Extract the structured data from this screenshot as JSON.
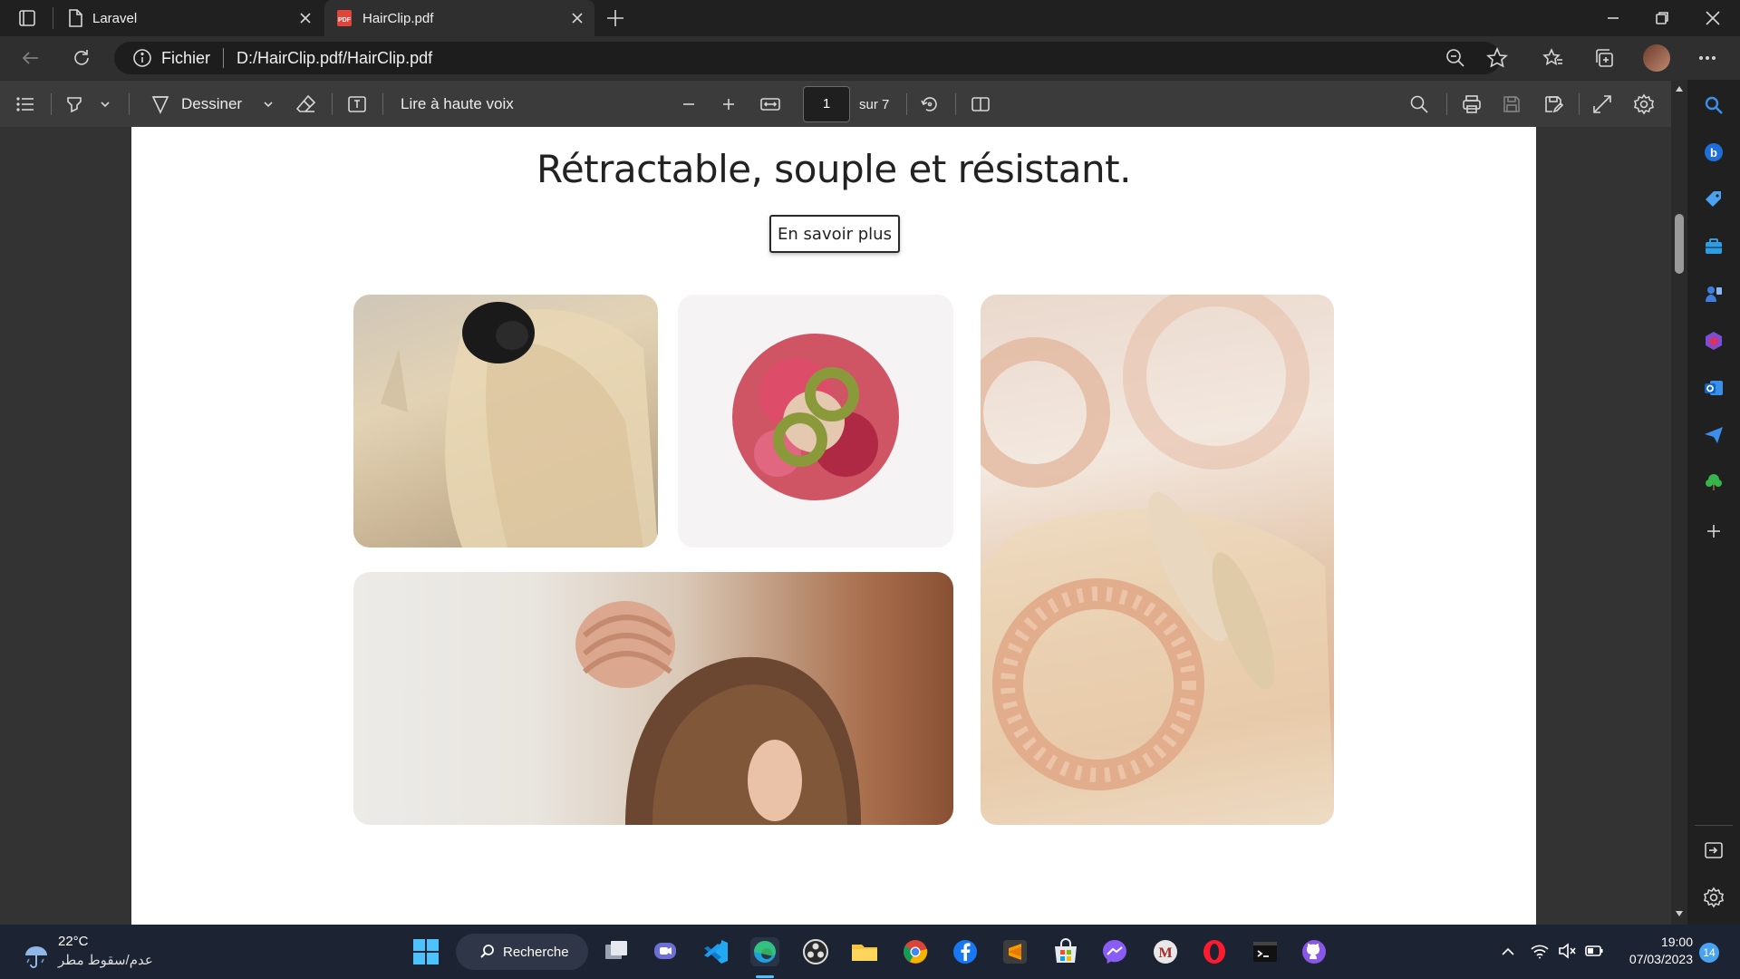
{
  "browser": {
    "tabs": [
      {
        "label": "Laravel",
        "icon": "page-icon",
        "active": false
      },
      {
        "label": "HairClip.pdf",
        "icon": "pdf-icon",
        "active": true
      }
    ],
    "address": {
      "prefix": "Fichier",
      "path": "D:/HairClip.pdf/HairClip.pdf"
    }
  },
  "pdf_toolbar": {
    "draw_label": "Dessiner",
    "read_aloud_label": "Lire à haute voix",
    "page_current": "1",
    "page_total_label": "sur 7"
  },
  "pdf_page": {
    "heading": "Rétractable, souple et résistant.",
    "button_label": "En savoir plus"
  },
  "taskbar": {
    "weather_temp": "22°C",
    "weather_condition": "عدم/سقوط مطر",
    "search_label": "Recherche",
    "time": "19:00",
    "date": "07/03/2023",
    "notification_count": "14"
  },
  "colors": {
    "accent": "#4aa3f2",
    "page_bg": "#ffffff",
    "viewer_bg": "#333333"
  }
}
